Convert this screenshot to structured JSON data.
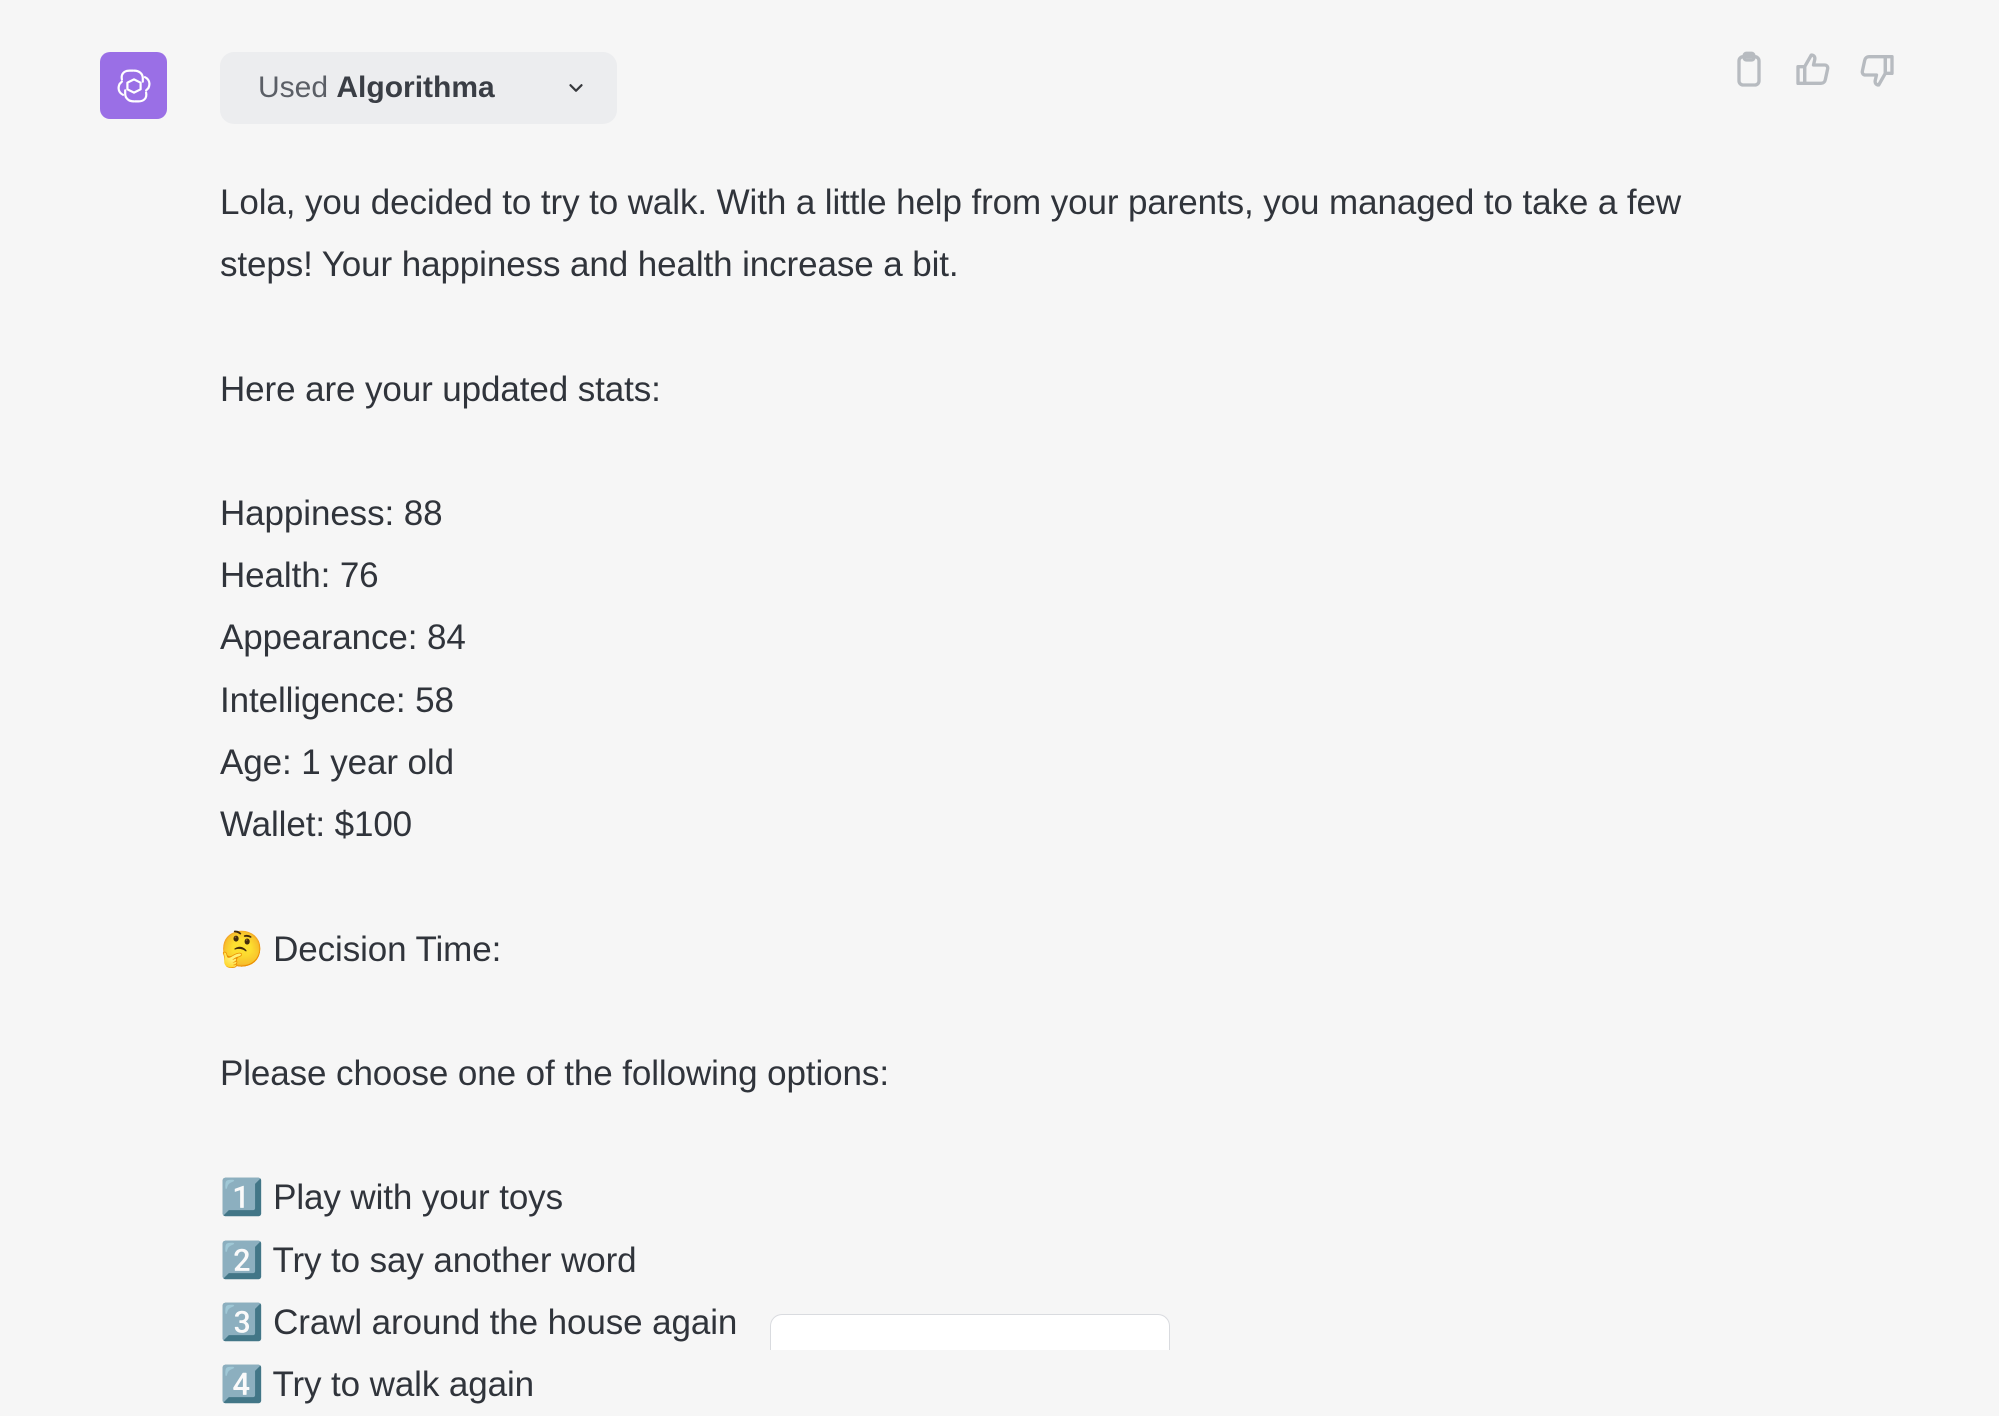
{
  "plugin": {
    "used_prefix": "Used ",
    "name": "Algorithma"
  },
  "message": {
    "intro": "Lola, you decided to try to walk. With a little help from your parents, you managed to take a few steps! Your happiness and health increase a bit.",
    "stats_header": "Here are your updated stats:",
    "stats": [
      "Happiness: 88",
      "Health: 76",
      "Appearance: 84",
      "Intelligence: 58",
      "Age: 1 year old",
      "Wallet: $100"
    ],
    "decision_label": "🤔 Decision Time:",
    "choose_prompt": "Please choose one of the following options:",
    "options": [
      "1️⃣ Play with your toys",
      "2️⃣ Try to say another word",
      "3️⃣ Crawl around the house again",
      "4️⃣ Try to walk again"
    ]
  },
  "icons": {
    "avatar": "openai-logo",
    "chevron": "chevron-down",
    "copy": "clipboard",
    "like": "thumbs-up",
    "dislike": "thumbs-down"
  }
}
